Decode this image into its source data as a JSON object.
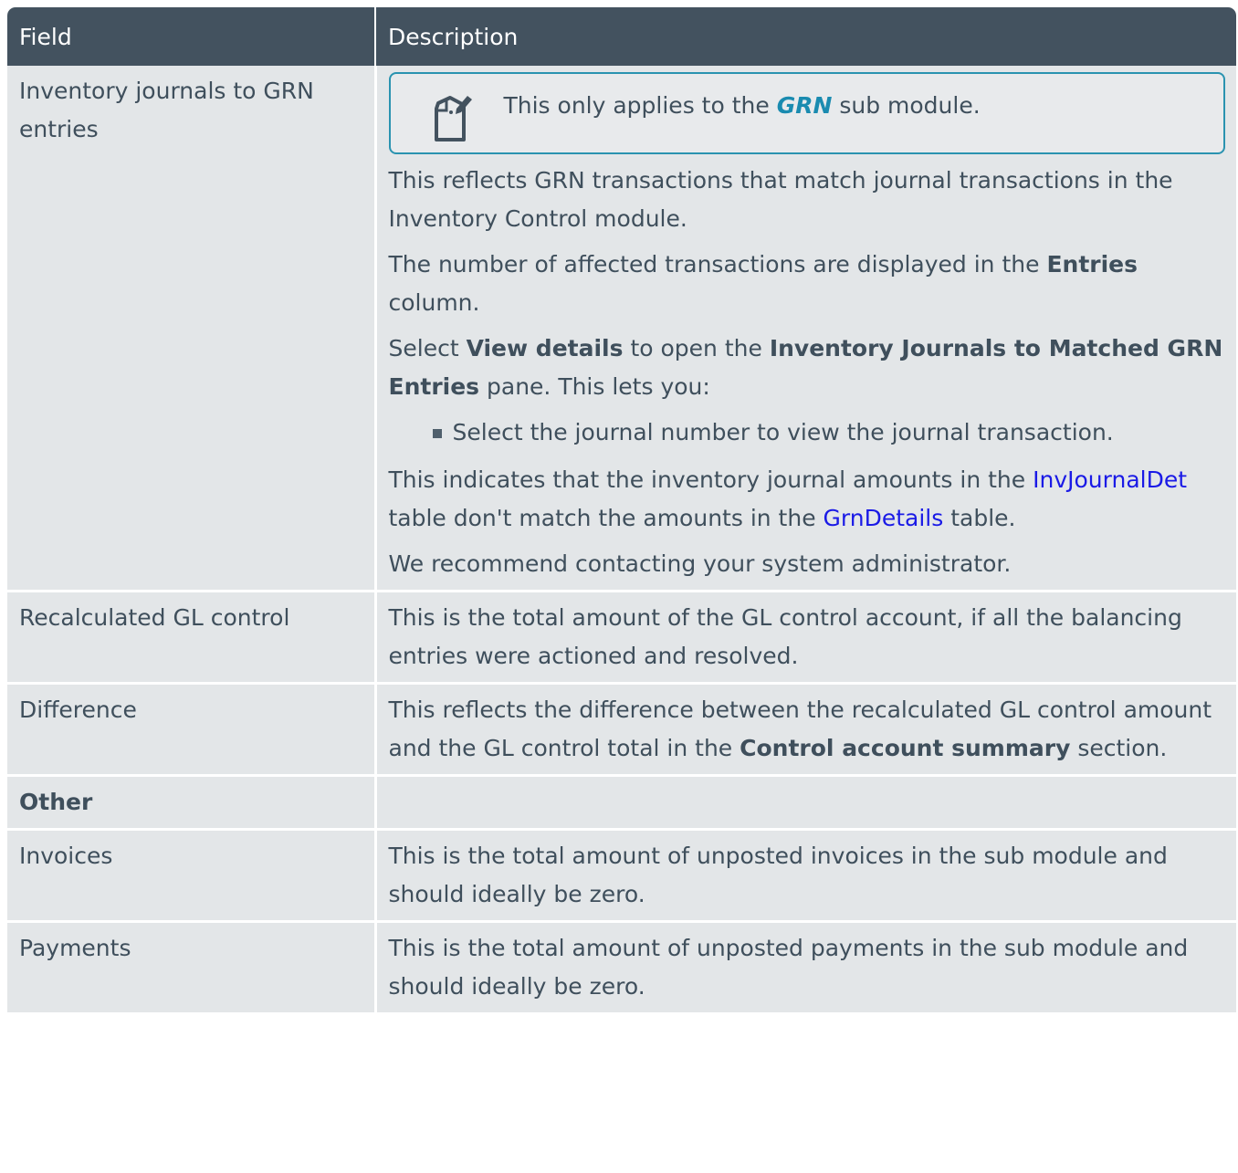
{
  "header": {
    "field": "Field",
    "description": "Description"
  },
  "rows": {
    "inventory": {
      "field": "Inventory journals to GRN entries",
      "note": {
        "pre": "This only applies to the ",
        "highlight": "GRN",
        "post": " sub module."
      },
      "p1": "This reflects GRN transactions that match journal transactions in the Inventory Control module.",
      "p2": {
        "pre": "The number of affected transactions are displayed in the ",
        "bold": "Entries",
        "post": " column."
      },
      "p3": {
        "pre": "Select ",
        "bold1": "View details",
        "mid": " to open the ",
        "bold2": "Inventory Journals to Matched GRN Entries",
        "post": " pane. This lets you:"
      },
      "bullet": "Select the journal number to view the journal transaction.",
      "p4": {
        "pre": "This indicates that the inventory journal amounts in the ",
        "link1": "InvJournalDet",
        "mid": " table don't match the amounts in the ",
        "link2": "GrnDetails",
        "post": " table."
      },
      "p5": "We recommend contacting your system administrator."
    },
    "recalc": {
      "field": "Recalculated GL control",
      "desc": "This is the total amount of the GL control account, if all the balancing entries were actioned and resolved."
    },
    "difference": {
      "field": "Difference",
      "pre": "This reflects the difference between the recalculated GL control amount and the GL control total in the ",
      "bold": "Control account summary",
      "post": " section."
    },
    "other": {
      "field": "Other"
    },
    "invoices": {
      "field": "Invoices",
      "desc": "This is the total amount of unposted invoices in the sub module and should ideally be zero."
    },
    "payments": {
      "field": "Payments",
      "desc": "This is the total amount of unposted payments in the sub module and should ideally be zero."
    }
  },
  "colors": {
    "header_bg": "#43525f",
    "row_bg": "#e3e6e8",
    "note_border": "#2a93b0",
    "link": "#1a1ae6"
  },
  "icons": {
    "note": "note-edit-icon"
  }
}
